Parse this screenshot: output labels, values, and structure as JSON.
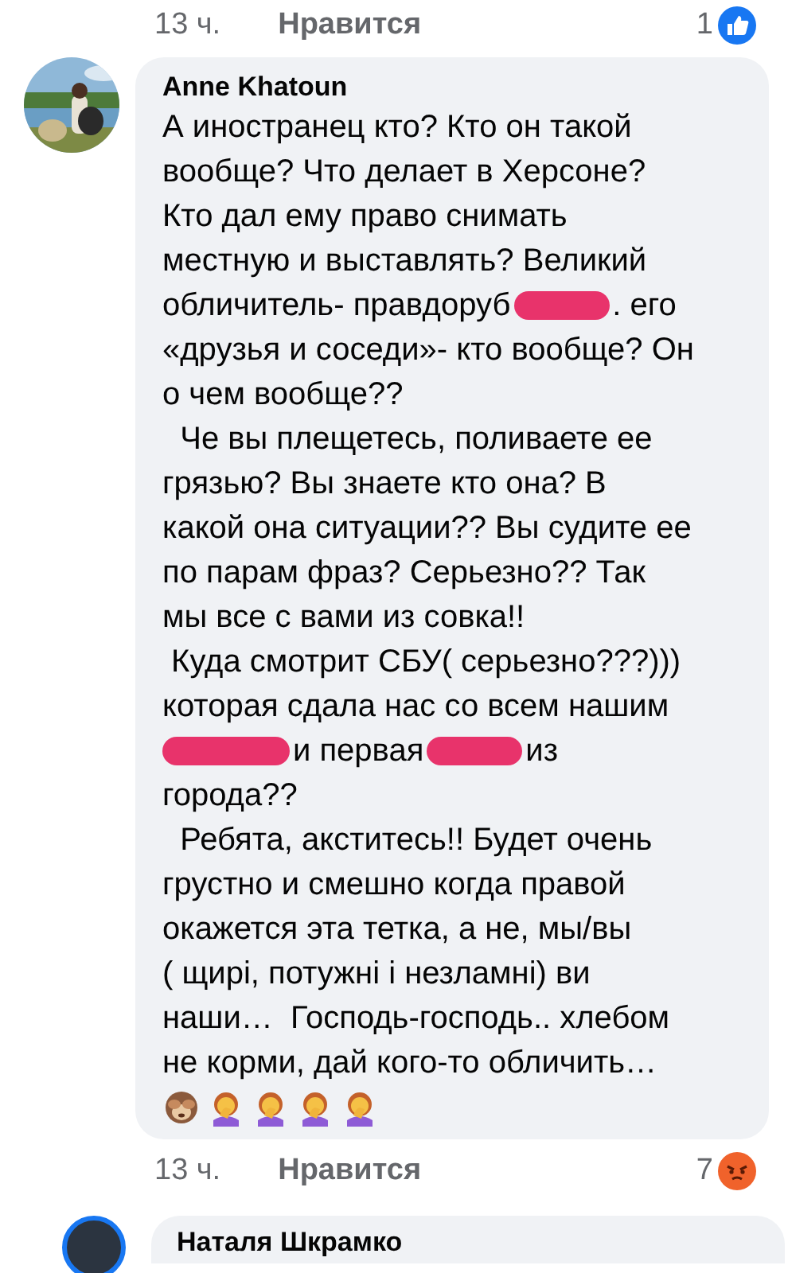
{
  "previous_footer": {
    "time": "13 ч.",
    "like_action": "Нравится",
    "reaction": {
      "kind": "like",
      "count": "1"
    }
  },
  "comment": {
    "author": "Anne Khatoun",
    "avatar": {
      "kind": "picture"
    },
    "lines": [
      [
        {
          "kind": "text",
          "text": "А иностранец кто? Кто он такой"
        }
      ],
      [
        {
          "kind": "text",
          "text": "вообще? Что делает в Херсоне?"
        }
      ],
      [
        {
          "kind": "text",
          "text": "Кто дал ему право снимать"
        }
      ],
      [
        {
          "kind": "text",
          "text": "местную и выставлять? Великий"
        }
      ],
      [
        {
          "kind": "text",
          "text": "обличитель- правдоруб"
        },
        {
          "kind": "redaction"
        },
        {
          "kind": "text",
          "text": ". его"
        }
      ],
      [
        {
          "kind": "text",
          "text": "«друзья и соседи»- кто вообще? Он"
        }
      ],
      [
        {
          "kind": "text",
          "text": "о чем вообще??"
        }
      ],
      [
        {
          "kind": "text",
          "text": "  Че вы плещетесь, поливаете ее"
        }
      ],
      [
        {
          "kind": "text",
          "text": "грязью? Вы знаете кто она? В"
        }
      ],
      [
        {
          "kind": "text",
          "text": "какой она ситуации?? Вы судите ее"
        }
      ],
      [
        {
          "kind": "text",
          "text": "по парам фраз? Серьезно?? Так"
        }
      ],
      [
        {
          "kind": "text",
          "text": "мы все с вами из совка!!"
        }
      ],
      [
        {
          "kind": "text",
          "text": " Куда смотрит СБУ( серьезно???)))"
        }
      ],
      [
        {
          "kind": "text",
          "text": "которая сдала нас со всем нашим"
        }
      ],
      [
        {
          "kind": "redaction"
        },
        {
          "kind": "text",
          "text": "и первая"
        },
        {
          "kind": "redaction"
        },
        {
          "kind": "text",
          "text": "из"
        }
      ],
      [
        {
          "kind": "text",
          "text": "города??"
        }
      ],
      [
        {
          "kind": "text",
          "text": "  Ребята, акститесь!! Будет очень"
        }
      ],
      [
        {
          "kind": "text",
          "text": "грустно и смешно когда правой"
        }
      ],
      [
        {
          "kind": "text",
          "text": "окажется эта тетка, а не, мы/вы"
        }
      ],
      [
        {
          "kind": "text",
          "text": "( щирі, потужні і незламні) ви"
        }
      ],
      [
        {
          "kind": "text",
          "text": "наши…  Господь-господь.. хлебом"
        }
      ],
      [
        {
          "kind": "text",
          "text": "не корми, дай кого-то обличить…"
        }
      ]
    ],
    "emojis": [
      {
        "kind": "monkey"
      },
      {
        "kind": "facepalm"
      },
      {
        "kind": "facepalm"
      },
      {
        "kind": "facepalm"
      },
      {
        "kind": "facepalm"
      }
    ],
    "footer": {
      "time": "13 ч.",
      "like_action": "Нравится",
      "reaction": {
        "kind": "angry",
        "count": "7"
      }
    }
  },
  "next_comment": {
    "author": "Наталя Шкрамко"
  }
}
